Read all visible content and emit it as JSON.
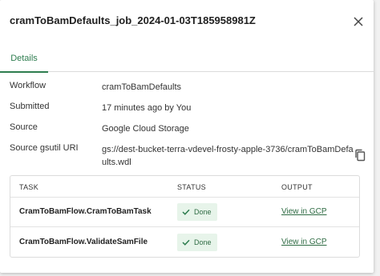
{
  "dialog": {
    "title": "cramToBamDefaults_job_2024-01-03T185958981Z",
    "close_icon": "close-icon"
  },
  "tabs": [
    {
      "label": "Details",
      "active": true
    }
  ],
  "details": {
    "workflow": {
      "label": "Workflow",
      "value": "cramToBamDefaults"
    },
    "submitted": {
      "label": "Submitted",
      "value": "17 minutes ago by You"
    },
    "source": {
      "label": "Source",
      "value": "Google Cloud Storage"
    },
    "uri": {
      "label": "Source gsutil URI",
      "value": "gs://dest-bucket-terra-vdevel-frosty-apple-3736/cramToBamDefaults.wdl",
      "copy_icon": "copy-icon"
    }
  },
  "table": {
    "headers": [
      "TASK",
      "STATUS",
      "OUTPUT"
    ],
    "rows": [
      {
        "task": "CramToBamFlow.CramToBamTask",
        "status": "Done",
        "output": "View in GCP"
      },
      {
        "task": "CramToBamFlow.ValidateSamFile",
        "status": "Done",
        "output": "View in GCP"
      }
    ]
  },
  "colors": {
    "accent": "#2e7d4f",
    "done_bg": "#e7f4ea"
  }
}
